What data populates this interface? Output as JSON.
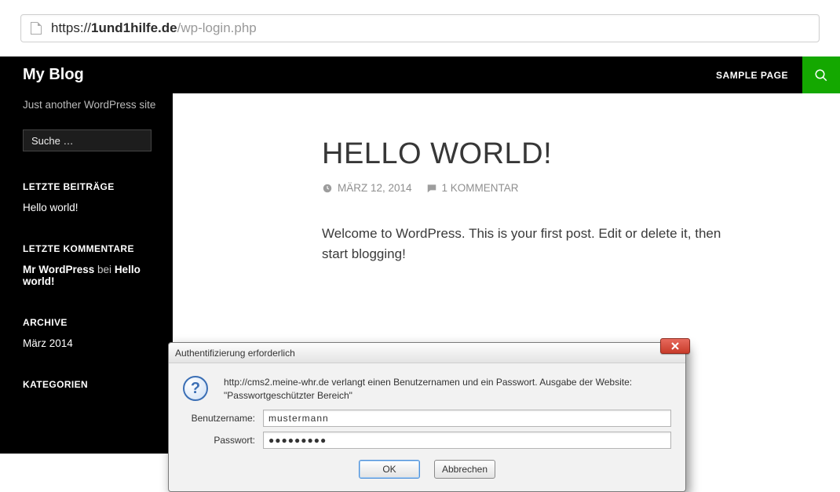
{
  "url": {
    "scheme": "https://",
    "host_bold": "1und1hilfe.de",
    "path": "/wp-login.php"
  },
  "header": {
    "site_title": "My Blog",
    "nav_link": "SAMPLE PAGE"
  },
  "sidebar": {
    "tagline": "Just another WordPress site",
    "search_placeholder": "Suche …",
    "widgets": {
      "recent_posts": {
        "title": "LETZTE BEITRÄGE",
        "items": [
          "Hello world!"
        ]
      },
      "recent_comments": {
        "title": "LETZTE KOMMENTARE",
        "item_author": "Mr WordPress",
        "item_connector": " bei ",
        "item_post": "Hello world!"
      },
      "archive": {
        "title": "ARCHIVE",
        "items": [
          "März 2014"
        ]
      },
      "categories": {
        "title": "KATEGORIEN"
      }
    }
  },
  "post": {
    "title": "HELLO WORLD!",
    "date": "MÄRZ 12, 2014",
    "comments": "1 KOMMENTAR",
    "body": "Welcome to WordPress. This is your first post. Edit or delete it, then start blogging!"
  },
  "dialog": {
    "title": "Authentifizierung erforderlich",
    "message_line1": "http://cms2.meine-whr.de verlangt einen Benutzernamen und ein Passwort. Ausgabe der Website:",
    "message_line2": "\"Passwortgeschützter Bereich\"",
    "username_label": "Benutzername:",
    "username_value": "mustermann",
    "password_label": "Passwort:",
    "password_value": "●●●●●●●●●",
    "ok": "OK",
    "cancel": "Abbrechen"
  }
}
